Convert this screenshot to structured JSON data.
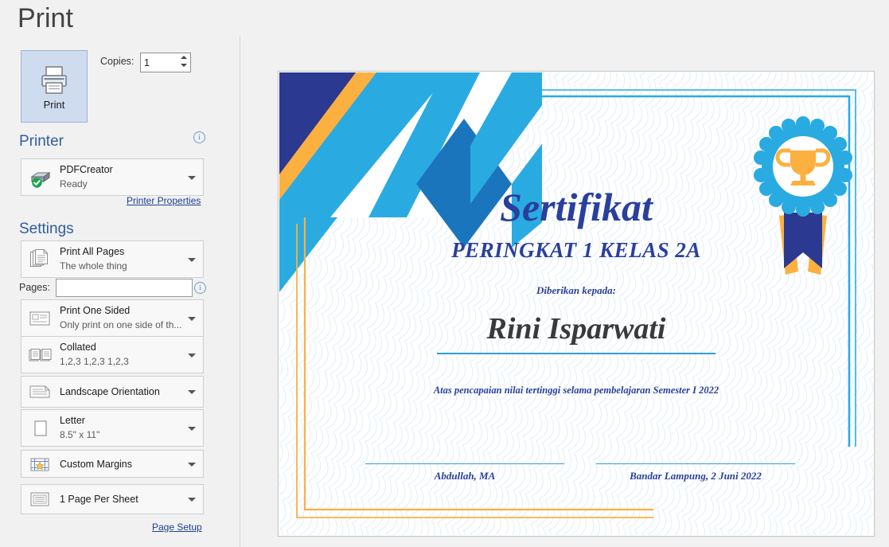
{
  "header": {
    "title": "Print"
  },
  "print_button": {
    "label": "Print",
    "icon": "printer-icon"
  },
  "copies": {
    "label": "Copies:",
    "value": "1"
  },
  "printer_section": {
    "title": "Printer",
    "info_icon": "info-icon",
    "selected_printer": "PDFCreator",
    "status": "Ready",
    "properties_link": "Printer Properties"
  },
  "settings_section": {
    "title": "Settings",
    "pages_label": "Pages:",
    "pages_value": "",
    "pages_placeholder": "",
    "page_setup_link": "Page Setup",
    "options": [
      {
        "primary": "Print All Pages",
        "secondary": "The whole thing",
        "icon": "all-pages-icon"
      },
      {
        "primary": "Print One Sided",
        "secondary": "Only print on one side of th...",
        "icon": "one-sided-icon"
      },
      {
        "primary": "Collated",
        "secondary": "1,2,3   1,2,3   1,2,3",
        "icon": "collated-icon"
      },
      {
        "primary": "Landscape Orientation",
        "secondary": "",
        "icon": "orientation-icon"
      },
      {
        "primary": "Letter",
        "secondary": "8.5\" x 11\"",
        "icon": "paper-size-icon"
      },
      {
        "primary": "Custom Margins",
        "secondary": "",
        "icon": "margins-icon"
      },
      {
        "primary": "1 Page Per Sheet",
        "secondary": "",
        "icon": "pages-per-sheet-icon"
      }
    ]
  },
  "preview": {
    "certificate": {
      "title": "Sertifikat",
      "subtitle": "PERINGKAT 1 KELAS 2A",
      "given_to_label": "Diberikan kepada:",
      "recipient": "Rini Isparwati",
      "reason": "Atas pencapaian nilai tertinggi selama pembelajaran Semester I 2022",
      "signature_left": "Abdullah, MA",
      "signature_right": "Bandar Lampung, 2 Juni 2022",
      "badge_icon": "award-trophy-badge-icon"
    }
  },
  "colors": {
    "navy": "#2b3990",
    "mid_blue": "#1b75bc",
    "light_blue": "#29abe2",
    "orange": "#fbb040",
    "accent_link": "#1a3f8f",
    "section_header": "#2e5d9e",
    "guilloche": "#cfe4f5"
  }
}
